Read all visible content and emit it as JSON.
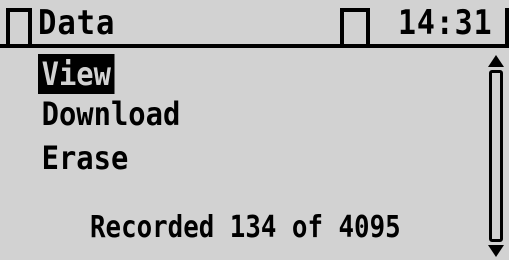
{
  "header": {
    "title": "Data",
    "time": "14:31"
  },
  "menu": {
    "items": [
      {
        "label": "View",
        "selected": true
      },
      {
        "label": "Download",
        "selected": false
      },
      {
        "label": "Erase",
        "selected": false
      }
    ]
  },
  "status": {
    "text": "Recorded 134 of 4095"
  },
  "colors": {
    "background": "#d2d2d2",
    "foreground": "#000000"
  },
  "icons": {
    "scroll_up": "scroll-up-arrow-icon",
    "scroll_down": "scroll-down-arrow-icon"
  }
}
